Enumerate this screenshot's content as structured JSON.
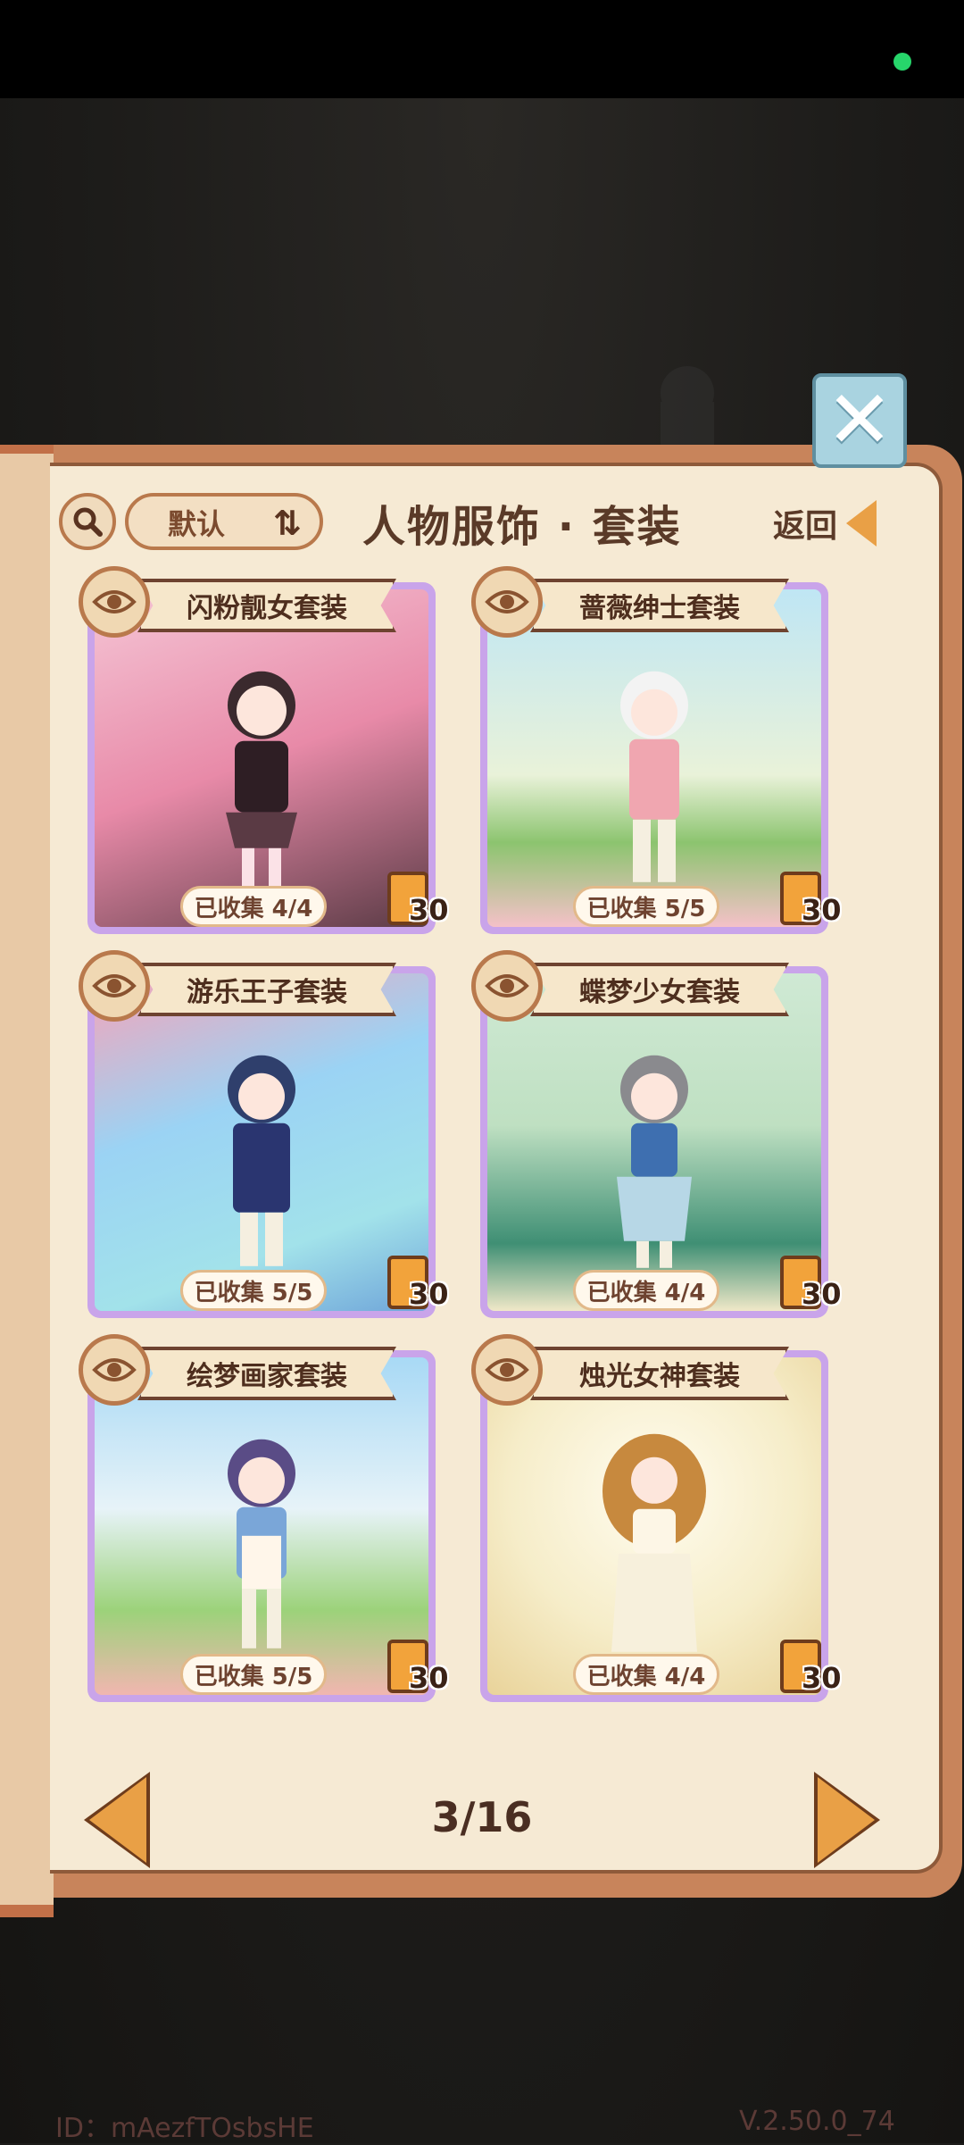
{
  "header": {
    "sort_label": "默认",
    "title": "人物服饰 · 套装",
    "back_label": "返回"
  },
  "cards": [
    {
      "name": "闪粉靓女套装",
      "collected": "已收集 4/4",
      "reward": "30"
    },
    {
      "name": "蔷薇绅士套装",
      "collected": "已收集 5/5",
      "reward": "30"
    },
    {
      "name": "游乐王子套装",
      "collected": "已收集 5/5",
      "reward": "30"
    },
    {
      "name": "蝶梦少女套装",
      "collected": "已收集 4/4",
      "reward": "30"
    },
    {
      "name": "绘梦画家套装",
      "collected": "已收集 5/5",
      "reward": "30"
    },
    {
      "name": "烛光女神套装",
      "collected": "已收集 4/4",
      "reward": "30"
    }
  ],
  "pagination": {
    "current": "3/16"
  },
  "footer": {
    "id_text": "ID：mAezfTOsbsHE",
    "version": "V.2.50.0_74"
  },
  "colors": {
    "accent": "#e9a046",
    "panel": "#f6ead4",
    "frame": "#c9a4ea"
  }
}
